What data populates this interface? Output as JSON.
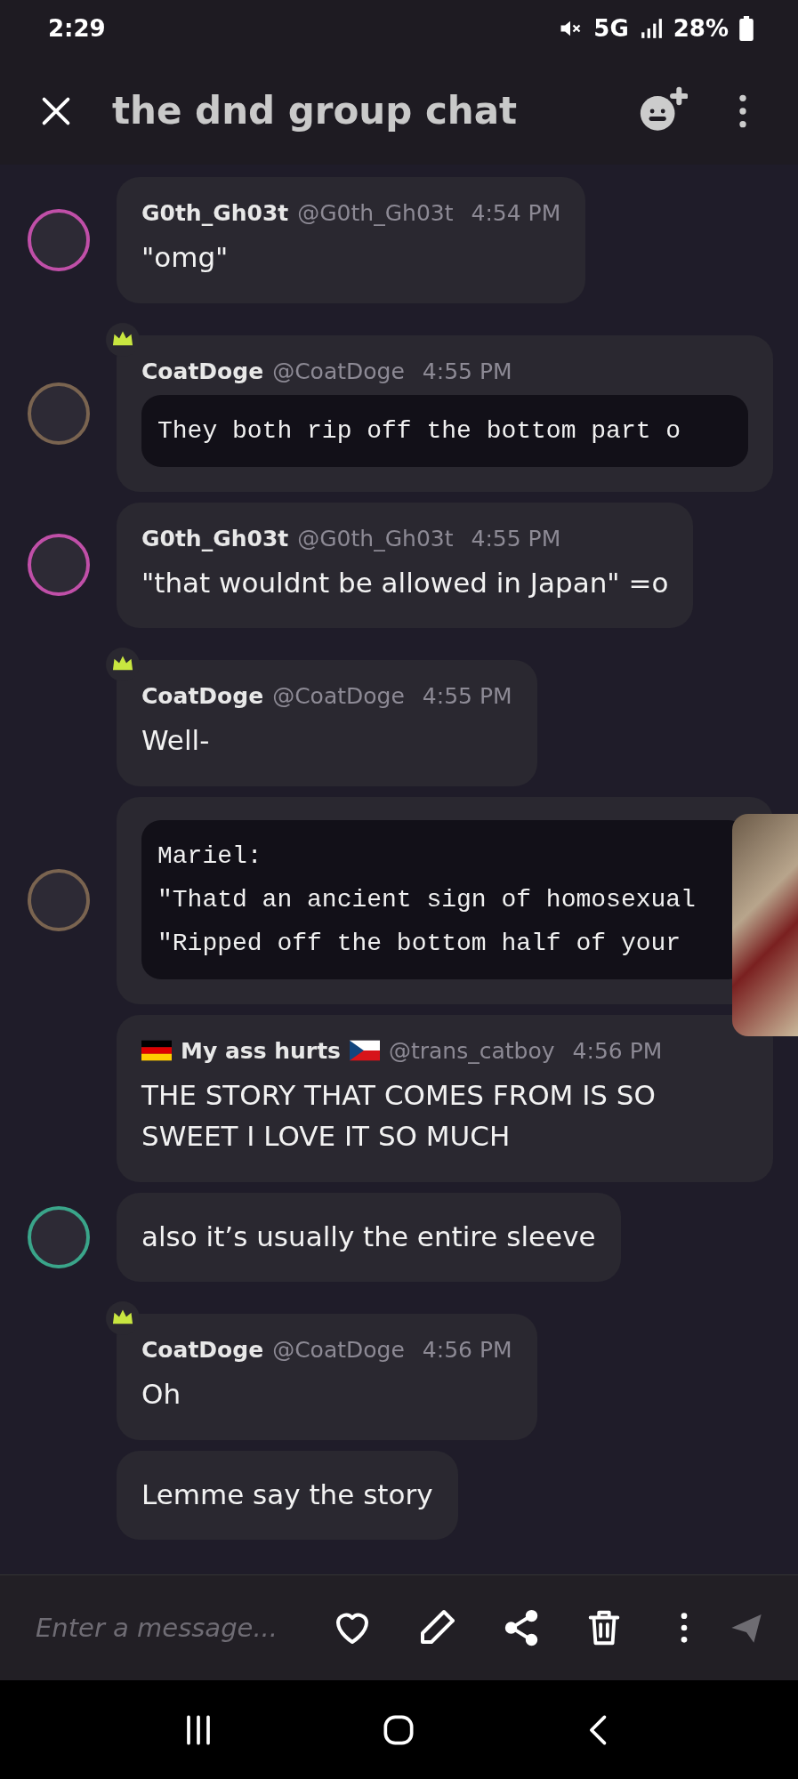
{
  "status_bar": {
    "time": "2:29",
    "network": "5G",
    "battery": "28%"
  },
  "header": {
    "title": "the dnd group chat"
  },
  "messages": [
    {
      "author": "G0th_Gh03t",
      "handle": "@G0th_Gh03t",
      "time": "4:54 PM",
      "owner": false,
      "flags": false,
      "avatar": true,
      "color": "#c04fa8",
      "text": "\"omg\""
    },
    {
      "author": "CoatDoge",
      "handle": "@CoatDoge",
      "time": "4:55 PM",
      "owner": true,
      "flags": false,
      "avatar": true,
      "color": "#7a6450",
      "code": [
        "They both rip off the bottom part o"
      ]
    },
    {
      "author": "G0th_Gh03t",
      "handle": "@G0th_Gh03t",
      "time": "4:55 PM",
      "owner": false,
      "flags": false,
      "avatar": true,
      "color": "#c04fa8",
      "text": "\"that wouldnt be allowed in Japan\" =o"
    },
    {
      "author": "CoatDoge",
      "handle": "@CoatDoge",
      "time": "4:55 PM",
      "owner": true,
      "flags": false,
      "avatar": false,
      "text": "Well-"
    },
    {
      "owner": false,
      "avatar": true,
      "color": "#7a6450",
      "code": [
        "Mariel:",
        "\"Thatd an ancient sign of homosexual",
        "\"Ripped off the bottom half of your"
      ]
    },
    {
      "author": "My ass hurts",
      "handle": "@trans_catboy",
      "time": "4:56 PM",
      "owner": false,
      "flags": true,
      "avatar": false,
      "text": "THE STORY THAT COMES FROM IS SO SWEET I LOVE IT SO MUCH"
    },
    {
      "owner": false,
      "avatar": true,
      "color": "#3aa58a",
      "text": "also it’s usually the entire sleeve"
    },
    {
      "author": "CoatDoge",
      "handle": "@CoatDoge",
      "time": "4:56 PM",
      "owner": true,
      "flags": false,
      "avatar": false,
      "text": "Oh"
    },
    {
      "owner": false,
      "avatar": false,
      "text": "Lemme say the story"
    }
  ],
  "composer": {
    "placeholder": "Enter a message..."
  }
}
